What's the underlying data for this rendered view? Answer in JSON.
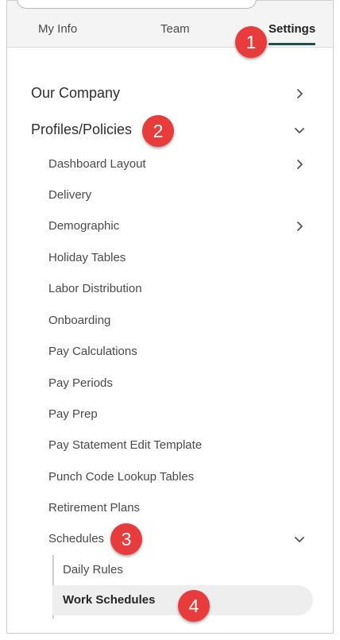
{
  "tabs": {
    "my_info": "My Info",
    "team": "Team",
    "settings": "Settings"
  },
  "menu": {
    "our_company": "Our Company",
    "profiles_policies": "Profiles/Policies",
    "items": [
      "Dashboard Layout",
      "Delivery",
      "Demographic",
      "Holiday Tables",
      "Labor Distribution",
      "Onboarding",
      "Pay Calculations",
      "Pay Periods",
      "Pay Prep",
      "Pay Statement Edit Template",
      "Punch Code Lookup Tables",
      "Retirement Plans",
      "Schedules"
    ],
    "schedules_sub": [
      "Daily Rules",
      "Work Schedules"
    ]
  },
  "badges": [
    "1",
    "2",
    "3",
    "4"
  ],
  "colors": {
    "accent": "#1f4f47",
    "badge": "#e83b3b",
    "selected_bg": "#eeeeee"
  },
  "icons": {
    "expand": "chevron-right-icon",
    "collapse": "chevron-down-icon"
  }
}
